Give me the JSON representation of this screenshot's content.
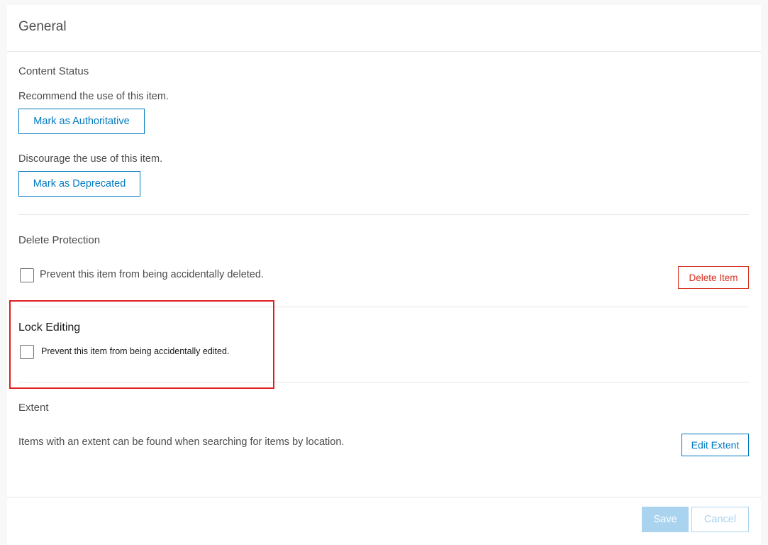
{
  "header": {
    "title": "General"
  },
  "content_status": {
    "title": "Content Status",
    "recommend_desc": "Recommend the use of this item.",
    "authoritative_label": "Mark as Authoritative",
    "discourage_desc": "Discourage the use of this item.",
    "deprecated_label": "Mark as Deprecated"
  },
  "delete_protection": {
    "title": "Delete Protection",
    "checkbox_label": "Prevent this item from being accidentally deleted.",
    "checked": false,
    "delete_label": "Delete Item"
  },
  "lock_editing": {
    "title": "Lock Editing",
    "checkbox_label": "Prevent this item from being accidentally edited.",
    "checked": false
  },
  "extent": {
    "title": "Extent",
    "desc": "Items with an extent can be found when searching for items by location.",
    "edit_label": "Edit Extent"
  },
  "footer": {
    "save_label": "Save",
    "cancel_label": "Cancel"
  },
  "colors": {
    "accent": "#0079c1",
    "danger": "#d83020",
    "highlight": "#e02020",
    "disabled_accent": "#a9d3ef"
  }
}
